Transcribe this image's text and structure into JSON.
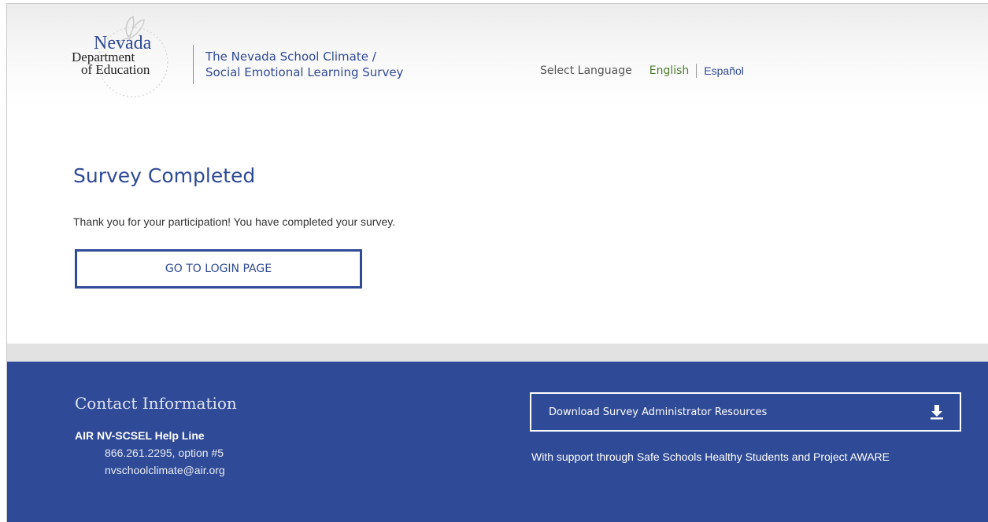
{
  "header": {
    "logo": {
      "line1": "Nevada",
      "line2": "Department",
      "line3": "of Education"
    },
    "site_title_line1": "The Nevada School Climate /",
    "site_title_line2": "Social Emotional Learning Survey",
    "language": {
      "label": "Select Language",
      "english": "English",
      "spanish": "Español"
    }
  },
  "main": {
    "title": "Survey Completed",
    "message": "Thank you for your participation! You have completed your survey.",
    "login_button": "GO TO LOGIN PAGE"
  },
  "footer": {
    "contact_title": "Contact Information",
    "helpline_title": "AIR NV-SCSEL Help Line",
    "phone": "866.261.2295, option #5",
    "email": "nvschoolclimate@air.org",
    "download_button": "Download Survey Administrator Resources",
    "download_icon": "download-icon",
    "support_text": "With support through Safe Schools Healthy Students and Project AWARE"
  },
  "colors": {
    "brand_blue": "#2f4a96",
    "english_green": "#4c7c2e"
  }
}
